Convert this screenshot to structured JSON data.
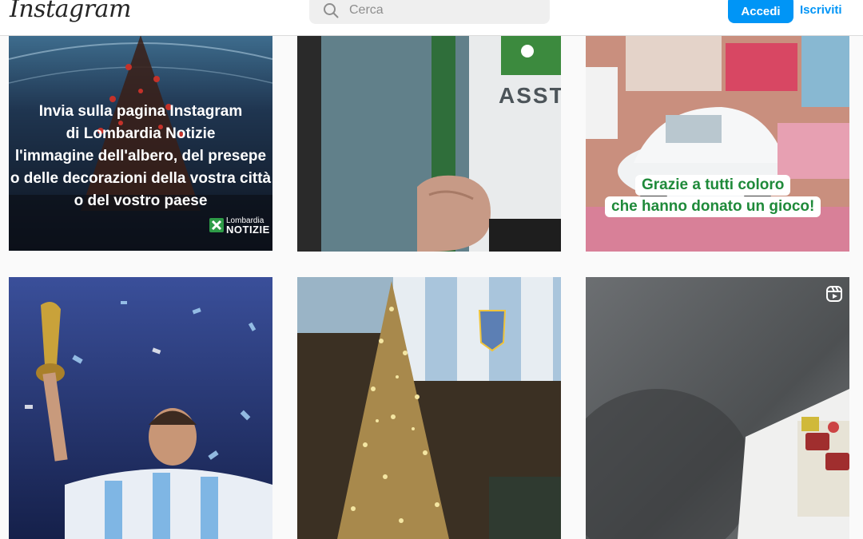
{
  "header": {
    "logo": "Instagram",
    "search": {
      "placeholder": "Cerca",
      "value": ""
    },
    "login_label": "Accedi",
    "signup_label": "Iscriviti"
  },
  "posts": [
    {
      "overlay_lines": [
        "Invia sulla pagina Instagram",
        "di Lombardia Notizie",
        "l'immagine dell'albero, del presepe",
        "o delle decorazioni della vostra città",
        "o del vostro paese"
      ],
      "brand_top": "Lombardia",
      "brand_bottom": "NOTIZIE"
    },
    {
      "sign_text": "ASST"
    },
    {
      "caption_lines": [
        "Grazie a tutti coloro",
        "che hanno donato un gioco!"
      ]
    },
    {},
    {},
    {
      "badge_icon": "reels-icon"
    }
  ],
  "colors": {
    "accent": "#0095f6",
    "caption_green": "#1f8a3a"
  }
}
